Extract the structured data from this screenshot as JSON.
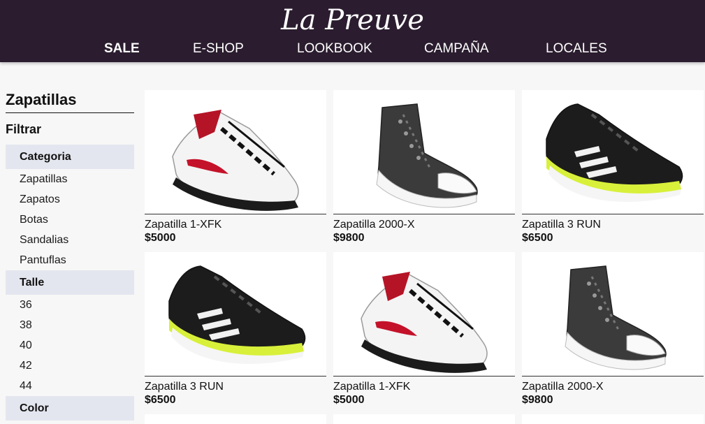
{
  "brand": {
    "logo": "La Preuve"
  },
  "nav": [
    {
      "label": "SALE"
    },
    {
      "label": "E-SHOP"
    },
    {
      "label": "LOOKBOOK"
    },
    {
      "label": "CAMPAÑA"
    },
    {
      "label": "LOCALES"
    }
  ],
  "sidebar": {
    "title": "Zapatillas",
    "filter_label": "Filtrar",
    "groups": [
      {
        "label": "Categoria",
        "items": [
          "Zapatillas",
          "Zapatos",
          "Botas",
          "Sandalias",
          "Pantuflas"
        ]
      },
      {
        "label": "Talle",
        "items": [
          "36",
          "38",
          "40",
          "42",
          "44"
        ]
      },
      {
        "label": "Color",
        "items": []
      }
    ]
  },
  "products": [
    {
      "name": "Zapatilla 1-XFK",
      "price": "$5000",
      "image": "white-red-tennis-shoe"
    },
    {
      "name": "Zapatilla 2000-X",
      "price": "$9800",
      "image": "dark-grey-high-top-sneaker"
    },
    {
      "name": "Zapatilla 3 RUN",
      "price": "$6500",
      "image": "black-lime-running-shoe"
    },
    {
      "name": "Zapatilla 3 RUN",
      "price": "$6500",
      "image": "black-lime-running-shoe"
    },
    {
      "name": "Zapatilla 1-XFK",
      "price": "$5000",
      "image": "white-red-tennis-shoe"
    },
    {
      "name": "Zapatilla 2000-X",
      "price": "$9800",
      "image": "dark-grey-high-top-sneaker"
    }
  ],
  "colors": {
    "header_bg": "#2b1d2f",
    "filter_head_bg": "#e4e6ef",
    "page_bg": "#f7f7f7"
  }
}
